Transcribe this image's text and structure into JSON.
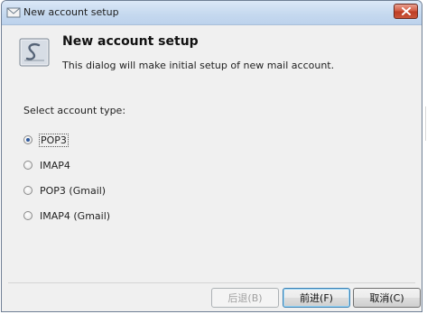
{
  "window": {
    "title": "New account setup"
  },
  "header": {
    "title": "New account setup",
    "description": "This dialog will make initial setup of new mail account."
  },
  "form": {
    "section_label": "Select account type:",
    "options": [
      {
        "label": "POP3",
        "checked": true
      },
      {
        "label": "IMAP4",
        "checked": false
      },
      {
        "label": "POP3 (Gmail)",
        "checked": false
      },
      {
        "label": "IMAP4 (Gmail)",
        "checked": false
      }
    ]
  },
  "buttons": {
    "back_label": "后退(B)",
    "next_label": "前进(F)",
    "cancel_label": "取消(C)"
  },
  "icons": {
    "window_icon": "envelope-icon",
    "logo_icon": "app-logo-icon",
    "close_icon": "close-icon"
  }
}
